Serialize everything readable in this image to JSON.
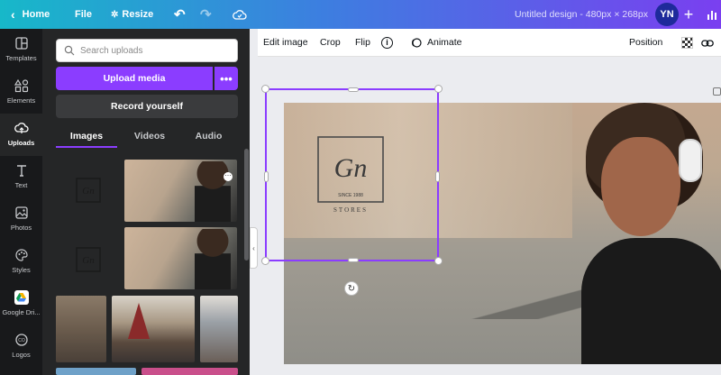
{
  "topbar": {
    "home_label": "Home",
    "file_label": "File",
    "resize_label": "Resize",
    "design_title": "Untitled design - 480px × 268px",
    "avatar_initials": "YN",
    "gradient_start": "#17b8c9",
    "gradient_end": "#7a3ff0"
  },
  "sidebar": {
    "items": [
      {
        "label": "Templates",
        "icon": "templates-icon"
      },
      {
        "label": "Elements",
        "icon": "elements-icon"
      },
      {
        "label": "Uploads",
        "icon": "upload-icon",
        "active": true
      },
      {
        "label": "Text",
        "icon": "text-icon"
      },
      {
        "label": "Photos",
        "icon": "photos-icon"
      },
      {
        "label": "Styles",
        "icon": "styles-icon"
      },
      {
        "label": "Google Dri...",
        "icon": "google-drive-icon"
      },
      {
        "label": "Logos",
        "icon": "logos-icon"
      }
    ]
  },
  "panel": {
    "search_placeholder": "Search uploads",
    "upload_label": "Upload media",
    "more_label": "•••",
    "record_label": "Record yourself",
    "tabs": [
      {
        "label": "Images",
        "active": true
      },
      {
        "label": "Videos"
      },
      {
        "label": "Audio"
      }
    ]
  },
  "toolbar": {
    "edit_image": "Edit image",
    "crop": "Crop",
    "flip": "Flip",
    "info": "i",
    "animate": "Animate",
    "position": "Position"
  },
  "logo": {
    "monogram": "Gn",
    "since": "SINCE 1988",
    "brand": "STORES"
  },
  "accent_color": "#8b3dff"
}
